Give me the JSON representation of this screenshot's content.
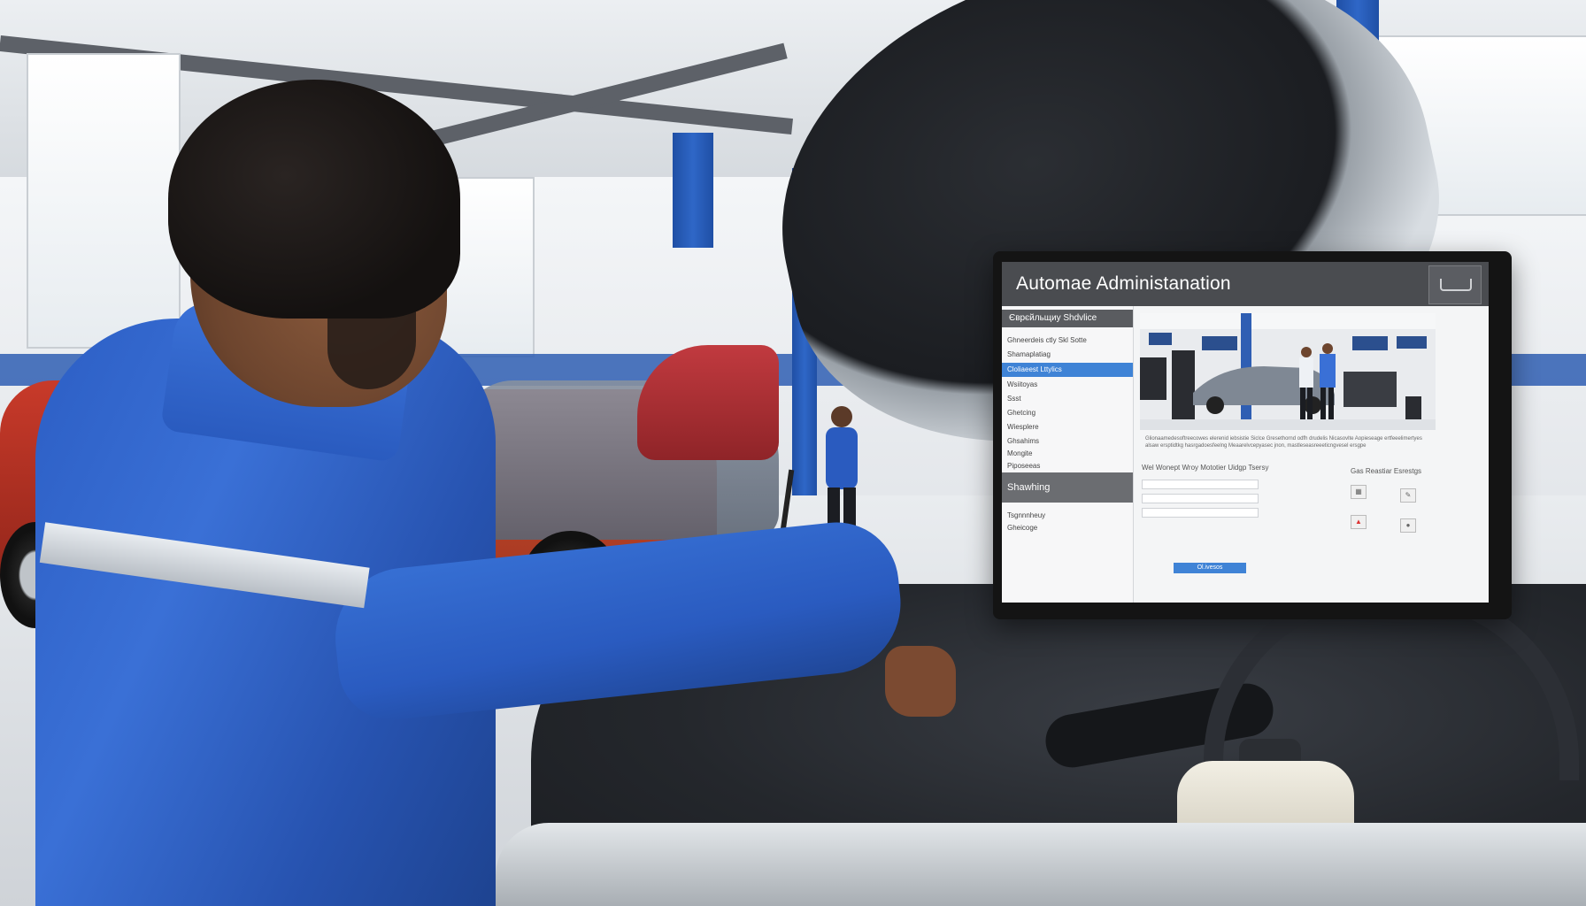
{
  "monitor": {
    "title": "Automae Administanation",
    "sidebar": {
      "header": "Єврєйльщиу Shdvlice",
      "items": [
        "Ghneerdeis ctly Skl Sotte",
        "Shamaplatiag",
        "Cloliaeest Lttylics",
        "Wsiitoyas",
        "Ssst",
        "Ghetcing",
        "Wiesplere",
        "Ghsahims",
        "Mongite",
        "Piposeeas"
      ],
      "active_index": 2,
      "section": "Shawhing",
      "footer_items": [
        "Tsgnnnheuy",
        "Gheicoge"
      ]
    },
    "main": {
      "body_text": "Glionaamedesoftreecowes elerenid iebsistie Siclce Gresethornd odfh drudelis Nicasovlte Aopieseage ertfeeelimertyes alsaw ersptidtkg hasrgadoesfeelng Meaarelvcepyasec jnon, mastleseasreeeticngvesel ersgpe",
      "form_label_left": "Wel Wonept Wroy Mototier Uidgp Tsersy",
      "form_label_right": "Gas Reastiar Esrestgs",
      "submit_label": "Ol.ivesos"
    }
  },
  "colors": {
    "jacket": "#2c5ec4",
    "monitor_accent": "#3f83d6",
    "titlebar": "#4a4c50"
  }
}
